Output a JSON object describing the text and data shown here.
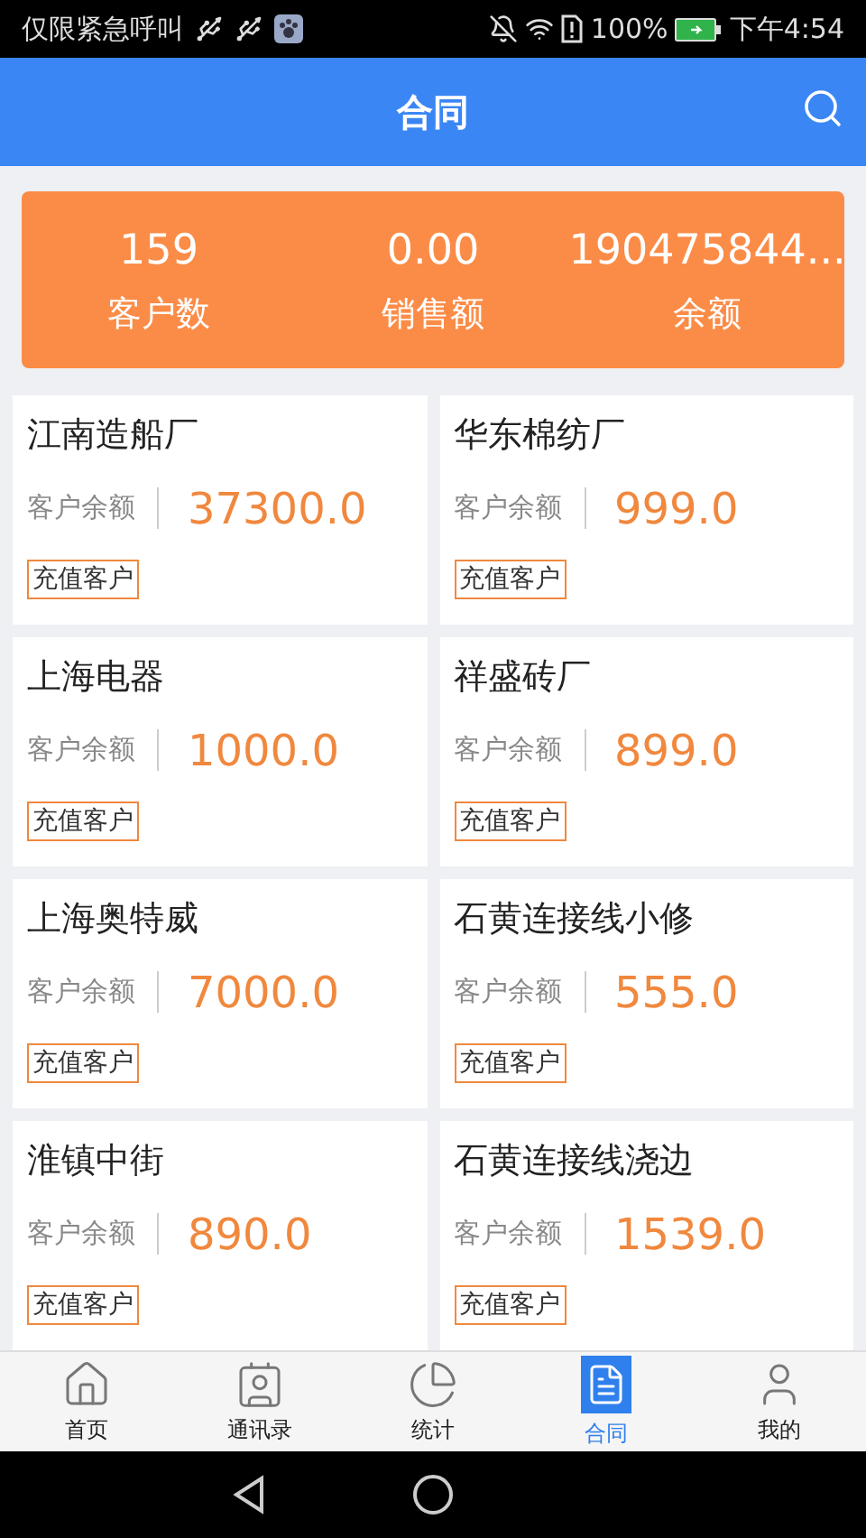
{
  "status_bar": {
    "carrier": "仅限紧急呼叫",
    "battery": "100%",
    "time": "下午4:54"
  },
  "header": {
    "title": "合同"
  },
  "summary": [
    {
      "value": "159",
      "label": "客户数"
    },
    {
      "value": "0.00",
      "label": "销售额"
    },
    {
      "value": "190475844...",
      "label": "余额"
    }
  ],
  "customers": [
    {
      "name": "江南造船厂",
      "balance_label": "客户余额",
      "balance": "37300.0",
      "tag": "充值客户"
    },
    {
      "name": "华东棉纺厂",
      "balance_label": "客户余额",
      "balance": "999.0",
      "tag": "充值客户"
    },
    {
      "name": "上海电器",
      "balance_label": "客户余额",
      "balance": "1000.0",
      "tag": "充值客户"
    },
    {
      "name": "祥盛砖厂",
      "balance_label": "客户余额",
      "balance": "899.0",
      "tag": "充值客户"
    },
    {
      "name": "上海奥特威",
      "balance_label": "客户余额",
      "balance": "7000.0",
      "tag": "充值客户"
    },
    {
      "name": "石黄连接线小修",
      "balance_label": "客户余额",
      "balance": "555.0",
      "tag": "充值客户"
    },
    {
      "name": "淮镇中街",
      "balance_label": "客户余额",
      "balance": "890.0",
      "tag": "充值客户"
    },
    {
      "name": "石黄连接线浇边",
      "balance_label": "客户余额",
      "balance": "1539.0",
      "tag": "充值客户"
    }
  ],
  "tabs": [
    {
      "label": "首页",
      "kind": "home",
      "selected": false
    },
    {
      "label": "通讯录",
      "kind": "contacts",
      "selected": false
    },
    {
      "label": "统计",
      "kind": "stats",
      "selected": false
    },
    {
      "label": "合同",
      "kind": "contract",
      "selected": true
    },
    {
      "label": "我的",
      "kind": "me",
      "selected": false
    }
  ]
}
